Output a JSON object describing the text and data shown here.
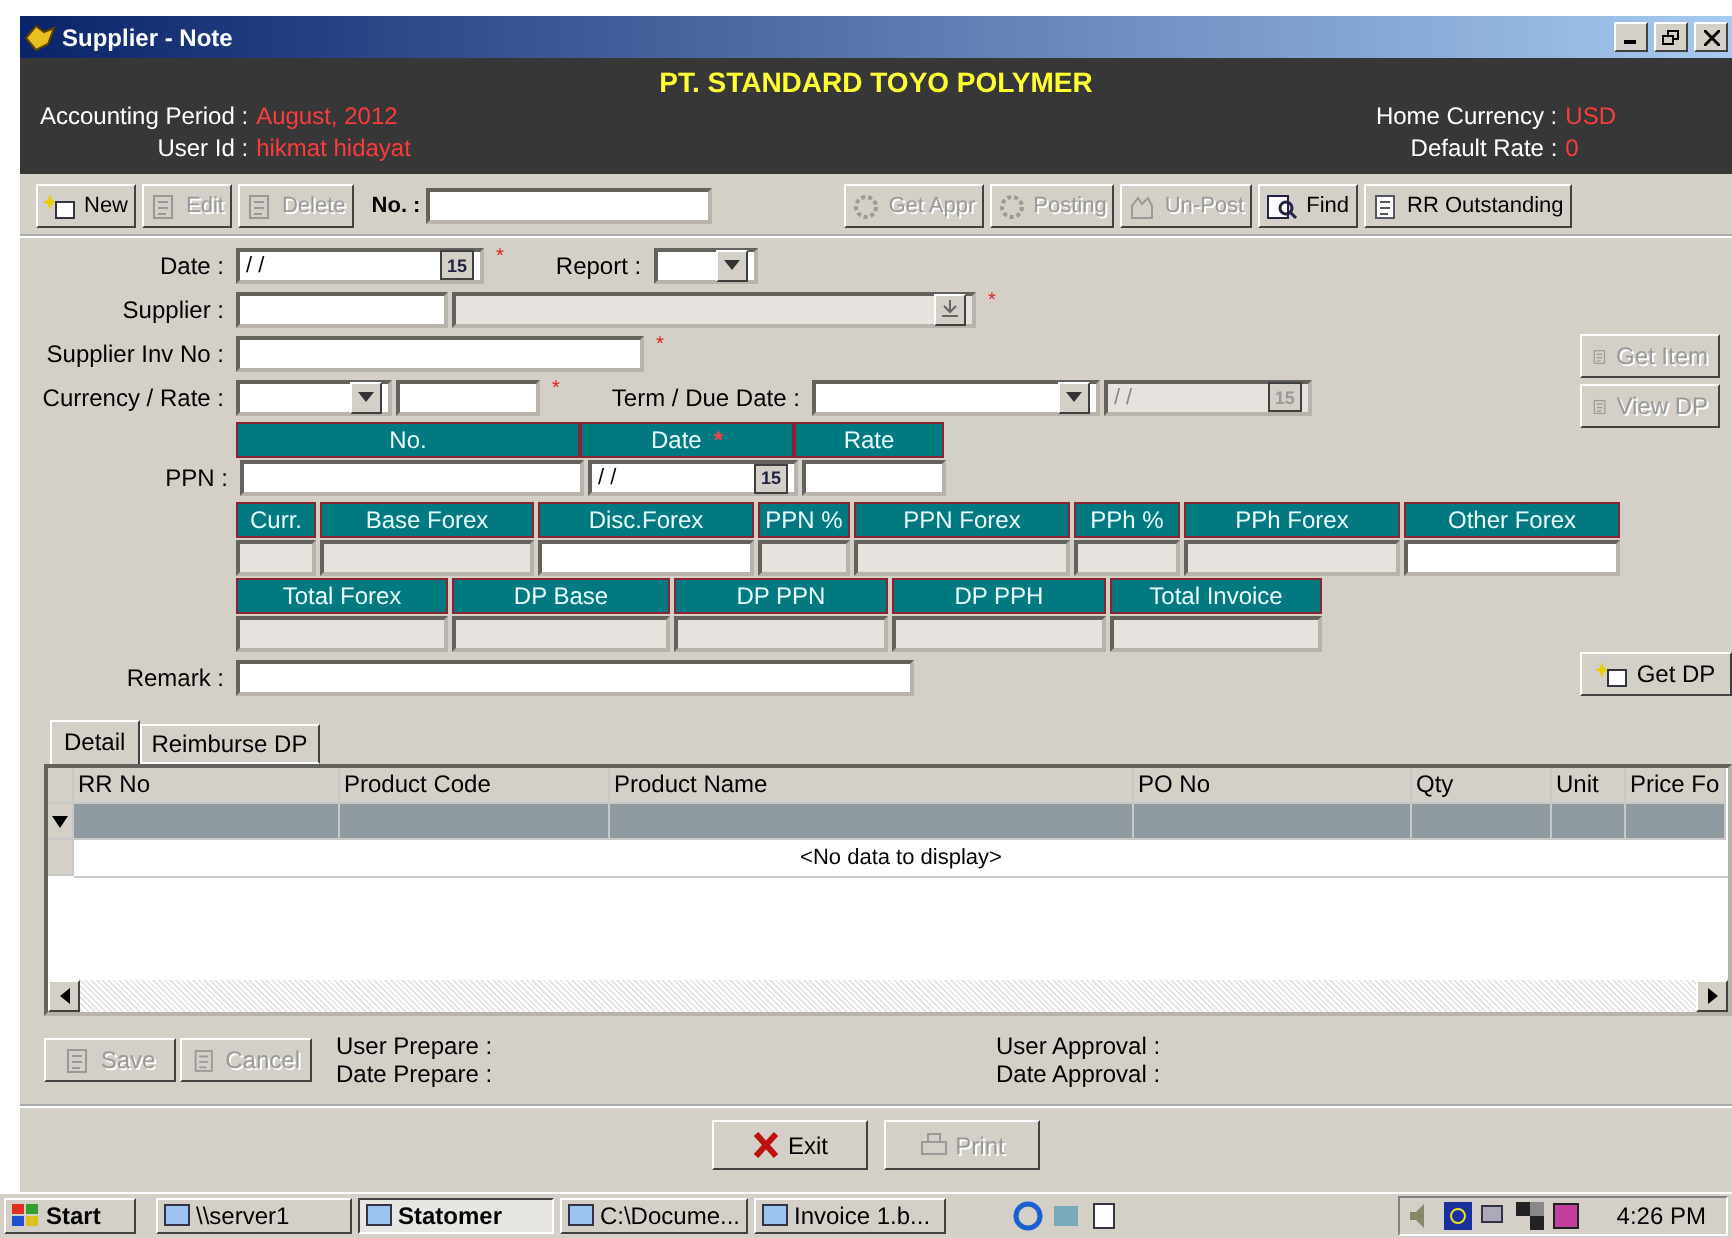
{
  "window": {
    "title": "Supplier - Note"
  },
  "header": {
    "company": "PT. STANDARD TOYO POLYMER",
    "info_left": [
      {
        "label": "Accounting Period :",
        "value": "August, 2012"
      },
      {
        "label": "User Id :",
        "value": "hikmat hidayat"
      }
    ],
    "info_right": [
      {
        "label": "Home Currency :",
        "value": "USD"
      },
      {
        "label": "Default Rate :",
        "value": "0"
      }
    ]
  },
  "toolbar": {
    "left_buttons": [
      {
        "label": "New",
        "kind": "new",
        "disabled": false
      },
      {
        "label": "Edit",
        "kind": "edit",
        "disabled": true
      },
      {
        "label": "Delete",
        "kind": "delete",
        "disabled": true
      }
    ],
    "no_label": "No. :",
    "right_buttons": [
      {
        "label": "Get Appr",
        "kind": "approve",
        "disabled": true
      },
      {
        "label": "Posting",
        "kind": "approve",
        "disabled": true
      },
      {
        "label": "Un-Post",
        "kind": "unpost",
        "disabled": true
      },
      {
        "label": "Find",
        "kind": "find",
        "disabled": false
      },
      {
        "label": "RR Outstanding",
        "kind": "list",
        "disabled": false
      }
    ]
  },
  "form": {
    "date": {
      "label": "Date :",
      "value": "/ /",
      "calendar": "15",
      "required": "*"
    },
    "report": {
      "label": "Report :"
    },
    "supplier": {
      "label": "Supplier :",
      "required": "*"
    },
    "supplier_inv_no": {
      "label": "Supplier Inv No :",
      "required": "*"
    },
    "currency_rate": {
      "label": "Currency / Rate :",
      "required": "*"
    },
    "term_due_date": {
      "label": "Term / Due Date :",
      "due_date": "/ /",
      "calendar": "15"
    },
    "ppn": {
      "label": "PPN :",
      "columns": [
        {
          "label": "No."
        },
        {
          "label": "Date",
          "required": "*"
        },
        {
          "label": "Rate"
        }
      ],
      "date_value": "/ /",
      "calendar": "15"
    },
    "forex_columns": [
      {
        "label": "Curr.",
        "disabled": true
      },
      {
        "label": "Base Forex",
        "disabled": true
      },
      {
        "label": "Disc.Forex",
        "disabled": false
      },
      {
        "label": "PPN %",
        "disabled": true
      },
      {
        "label": "PPN Forex",
        "disabled": true
      },
      {
        "label": "PPh %",
        "disabled": true
      },
      {
        "label": "PPh Forex",
        "disabled": true
      },
      {
        "label": "Other Forex",
        "disabled": false
      }
    ],
    "total_columns": [
      {
        "label": "Total Forex",
        "disabled": true
      },
      {
        "label": "DP Base",
        "disabled": true
      },
      {
        "label": "DP PPN",
        "disabled": true
      },
      {
        "label": "DP PPH",
        "disabled": true
      },
      {
        "label": "Total Invoice",
        "disabled": true
      }
    ],
    "remark": {
      "label": "Remark :"
    }
  },
  "side_buttons": [
    {
      "label": "Get Item",
      "disabled": true
    },
    {
      "label": "View DP",
      "disabled": true
    }
  ],
  "get_dp": {
    "label": "Get DP",
    "disabled": false
  },
  "tabs": [
    {
      "label": "Detail",
      "selected": true
    },
    {
      "label": "Reimburse DP",
      "selected": false
    }
  ],
  "grid": {
    "columns": [
      "RR No",
      "Product Code",
      "Product Name",
      "PO No",
      "Qty",
      "Unit",
      "Price Fo"
    ],
    "empty_text": "<No data to display>"
  },
  "footer": {
    "buttons": [
      {
        "label": "Save",
        "disabled": true
      },
      {
        "label": "Cancel",
        "disabled": true
      }
    ],
    "prepare": [
      "User Prepare :",
      "Date Prepare :"
    ],
    "approval": [
      "User Approval :",
      "Date Approval :"
    ]
  },
  "actions": [
    {
      "label": "Exit",
      "kind": "exit",
      "disabled": false
    },
    {
      "label": "Print",
      "kind": "print",
      "disabled": true
    }
  ],
  "taskbar": {
    "start": "Start",
    "tasks": [
      {
        "label": "\\\\server1",
        "selected": false
      },
      {
        "label": "Statomer",
        "selected": true
      },
      {
        "label": "C:\\Docume...",
        "selected": false
      },
      {
        "label": "Invoice 1.b...",
        "selected": false
      }
    ],
    "clock": "4:26 PM"
  }
}
